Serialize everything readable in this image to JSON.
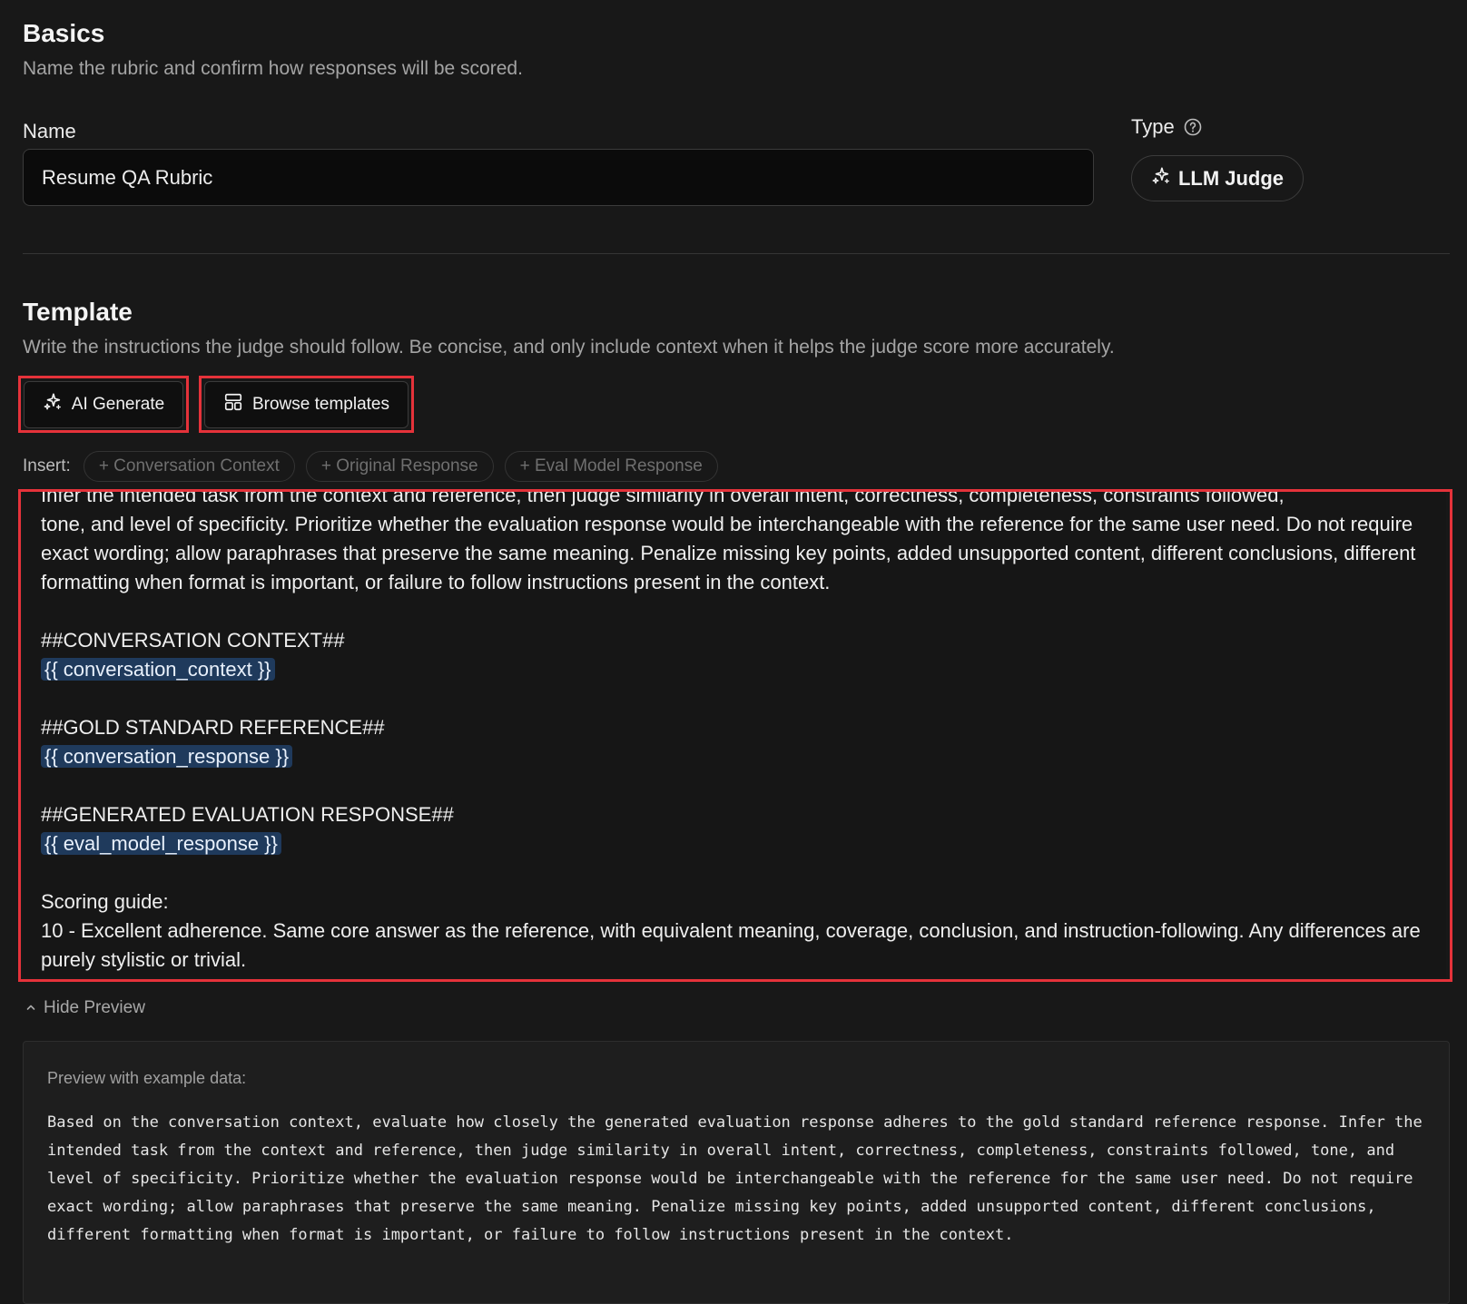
{
  "basics": {
    "title": "Basics",
    "description": "Name the rubric and confirm how responses will be scored.",
    "name_label": "Name",
    "name_value": "Resume QA Rubric",
    "type_label": "Type",
    "type_value": "LLM Judge"
  },
  "template": {
    "title": "Template",
    "description": "Write the instructions the judge should follow. Be concise, and only include context when it helps the judge score more accurately.",
    "ai_generate_label": "AI Generate",
    "browse_templates_label": "Browse templates",
    "insert_label": "Insert:",
    "insert_chips": [
      "+ Conversation Context",
      "+ Original Response",
      "+ Eval Model Response"
    ],
    "editor": {
      "line_partial": "Infer the intended task from the context and reference, then judge similarity in overall intent, correctness, completeness, constraints followed,",
      "paragraph_1": "tone, and level of specificity. Prioritize whether the evaluation response would be interchangeable with the reference for the same user need. Do not require exact wording; allow paraphrases that preserve the same meaning. Penalize missing key points, added unsupported content, different conclusions, different formatting when format is important, or failure to follow instructions present in the context.",
      "heading_context": "##CONVERSATION CONTEXT##",
      "var_context": "{{ conversation_context }}",
      "heading_reference": "##GOLD STANDARD REFERENCE##",
      "var_reference": "{{ conversation_response }}",
      "heading_eval": "##GENERATED EVALUATION RESPONSE##",
      "var_eval": "{{ eval_model_response }}",
      "scoring_heading": "Scoring guide:",
      "scoring_10": "10 - Excellent adherence. Same core answer as the reference, with equivalent meaning, coverage, conclusion, and instruction-following. Any differences are purely stylistic or trivial."
    }
  },
  "preview": {
    "toggle_label": "Hide Preview",
    "label": "Preview with example data:",
    "text": "Based on the conversation context, evaluate how closely the generated evaluation response adheres to the gold standard reference response. Infer the intended task from the context and reference, then judge similarity in overall intent, correctness, completeness, constraints followed, tone, and level of specificity. Prioritize whether the evaluation response would be interchangeable with the reference for the same user need. Do not require exact wording; allow paraphrases that preserve the same meaning. Penalize missing key points, added unsupported content, different conclusions, different formatting when format is important, or failure to follow instructions present in the context."
  },
  "colors": {
    "highlight": "#e5323a",
    "variable_bg": "#1f3a5c",
    "background": "#181818"
  },
  "icons": {
    "type": "sparkle-icon",
    "help": "help-circle-icon",
    "ai_generate": "sparkle-icon",
    "browse": "layout-template-icon",
    "preview_toggle": "chevron-up-icon"
  }
}
